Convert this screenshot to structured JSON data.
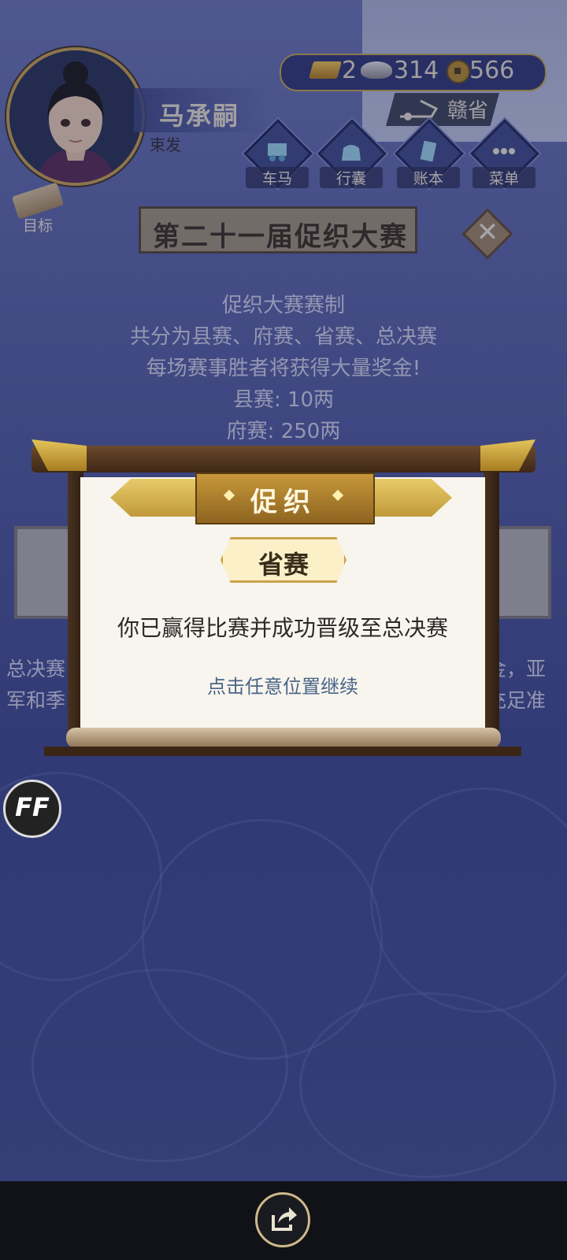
{
  "header": {
    "player_name": "马承嗣",
    "player_title": "束发",
    "currency": {
      "gold": "2",
      "silver": "314",
      "coins": "566"
    },
    "province": "赣省"
  },
  "nav": [
    {
      "label": "车马",
      "icon": "carriage-icon"
    },
    {
      "label": "行囊",
      "icon": "bag-icon"
    },
    {
      "label": "账本",
      "icon": "ledger-icon"
    },
    {
      "label": "菜单",
      "icon": "menu-icon"
    }
  ],
  "goal": {
    "label": "目标"
  },
  "tournament": {
    "title": "第二十一届促织大赛",
    "rules": [
      "促织大赛赛制",
      "共分为县赛、府赛、省赛、总决赛",
      "每场赛事胜者将获得大量奖金!",
      "县赛: 10两",
      "府赛: 250两"
    ],
    "side_left": [
      "总决赛",
      "军和季"
    ],
    "side_right": [
      "金，亚",
      "充足准"
    ]
  },
  "dialog": {
    "header": "促织",
    "stage": "省赛",
    "message": "你已赢得比赛并成功晋级至总决赛",
    "hint": "点击任意位置继续"
  },
  "fast_forward": {
    "label": "FF"
  },
  "colors": {
    "gold": "#c9a24a",
    "background": "#4f5a9a",
    "paper": "#f8f5ee"
  }
}
